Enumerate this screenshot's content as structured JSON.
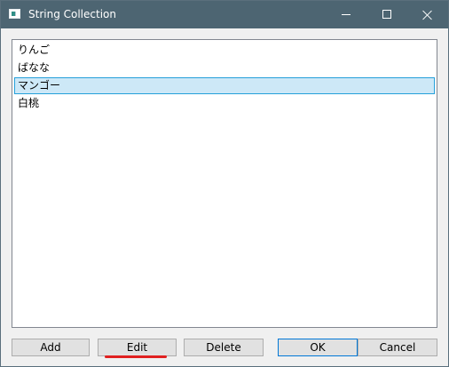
{
  "window": {
    "title": "String Collection"
  },
  "titlebar": {
    "icon": "window-app-icon",
    "minimize_icon": "minimize-icon",
    "maximize_icon": "maximize-icon",
    "close_icon": "close-icon"
  },
  "list": {
    "items": [
      "りんご",
      "ばなな",
      "マンゴー",
      "白桃"
    ],
    "selected_index": 2
  },
  "buttons": {
    "add": "Add",
    "edit": "Edit",
    "delete": "Delete",
    "ok": "OK",
    "cancel": "Cancel"
  },
  "colors": {
    "titlebar": "#4d6572",
    "selection_background": "#cde8f7",
    "selection_border": "#26a0da",
    "highlight_mark": "#e02020"
  }
}
